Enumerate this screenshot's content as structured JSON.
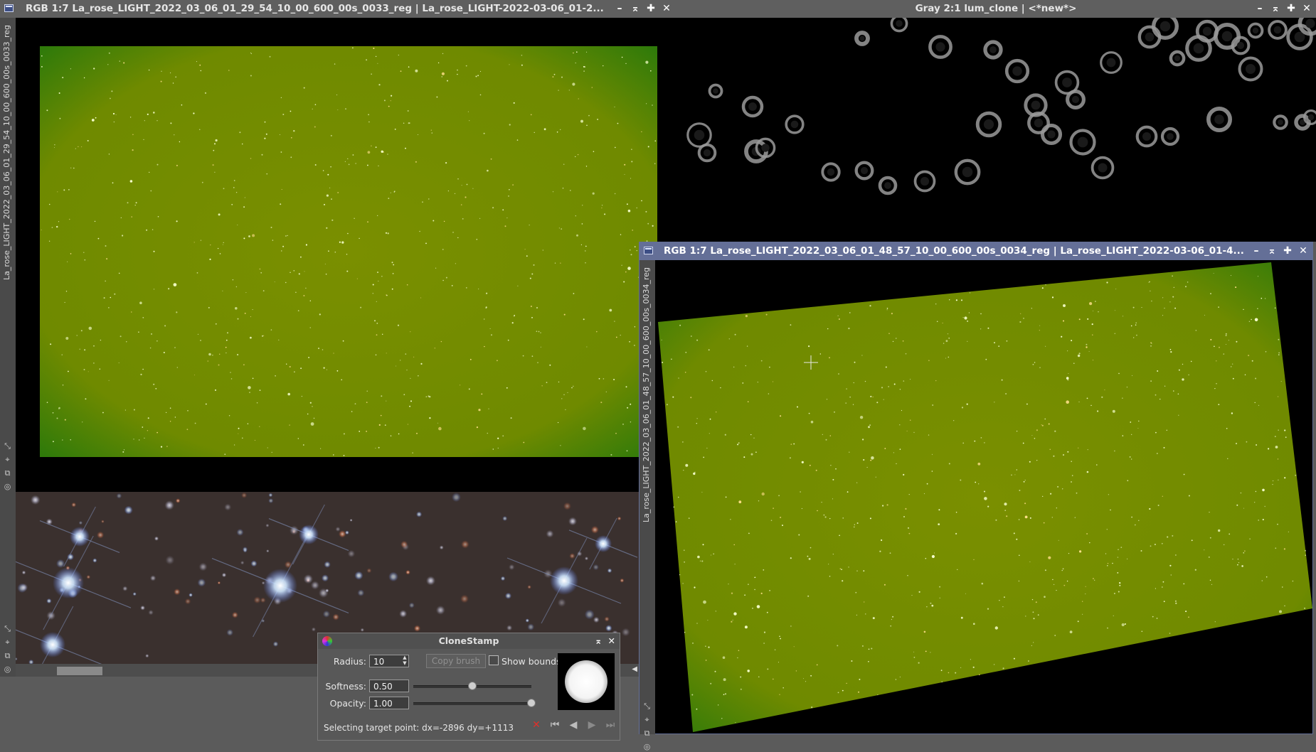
{
  "windows": {
    "main_left": {
      "title": "RGB 1:7 La_rose_LIGHT_2022_03_06_01_29_54_10_00_600_00s_0033_reg | La_rose_LIGHT-2022-03-06_01-2...",
      "side_label": "La_rose_LIGHT_2022_03_06_01_29_54_10_00_600_00s_0033_reg"
    },
    "gray_clone": {
      "title": "Gray 2:1 lum_clone | <*new*>"
    },
    "main_right": {
      "title": "RGB 1:7 La_rose_LIGHT_2022_03_06_01_48_57_10_00_600_00s_0034_reg | La_rose_LIGHT_2022-03-06_01-4...",
      "side_label": "La_rose_LIGHT_2022_03_06_01_48_57_10_00_600_00s_0034_reg"
    }
  },
  "controls": {
    "minimize": "–",
    "shade": "⌅",
    "maximize": "✚",
    "close": "✕"
  },
  "clone_stamp": {
    "title": "CloneStamp",
    "radius_label": "Radius:",
    "radius_value": "10",
    "copy_brush_label": "Copy brush",
    "show_bounds_label": "Show bounds",
    "softness_label": "Softness:",
    "softness_value": "0.50",
    "softness_level": 0.5,
    "opacity_label": "Opacity:",
    "opacity_value": "1.00",
    "opacity_level": 1.0,
    "status": "Selecting target point: dx=-2896 dy=+1113"
  },
  "colors": {
    "accent_titlebar": "#646f97",
    "image_green": "#6f8a00",
    "cancel_red": "#e0302a"
  },
  "icons": [
    "window-icon",
    "minimize-icon",
    "shade-icon",
    "maximize-icon",
    "close-icon",
    "crosshair-icon",
    "first-icon",
    "prev-icon",
    "next-icon",
    "last-icon",
    "cancel-icon"
  ]
}
